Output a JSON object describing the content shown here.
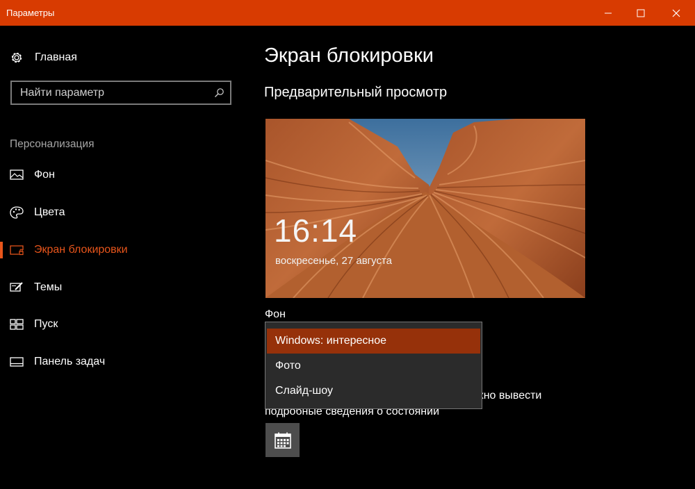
{
  "window": {
    "title": "Параметры",
    "accent_color": "#d83b01"
  },
  "sidebar": {
    "home_label": "Главная",
    "search_placeholder": "Найти параметр",
    "section_label": "Персонализация",
    "items": [
      {
        "label": "Фон",
        "icon": "picture-icon",
        "active": false
      },
      {
        "label": "Цвета",
        "icon": "palette-icon",
        "active": false
      },
      {
        "label": "Экран блокировки",
        "icon": "lock-screen-icon",
        "active": true
      },
      {
        "label": "Темы",
        "icon": "themes-icon",
        "active": false
      },
      {
        "label": "Пуск",
        "icon": "start-icon",
        "active": false
      },
      {
        "label": "Панель задач",
        "icon": "taskbar-icon",
        "active": false
      }
    ]
  },
  "main": {
    "title": "Экран блокировки",
    "preview_header": "Предварительный просмотр",
    "preview": {
      "time": "16:14",
      "date": "воскресенье, 27 августа"
    },
    "background_label": "Фон",
    "status_text_line1": "жно вывести",
    "status_text_line2": "подробные сведения о состоянии"
  },
  "dropdown": {
    "options": [
      {
        "label": "Windows: интересное",
        "selected": true
      },
      {
        "label": "Фото",
        "selected": false
      },
      {
        "label": "Слайд-шоу",
        "selected": false
      }
    ]
  }
}
